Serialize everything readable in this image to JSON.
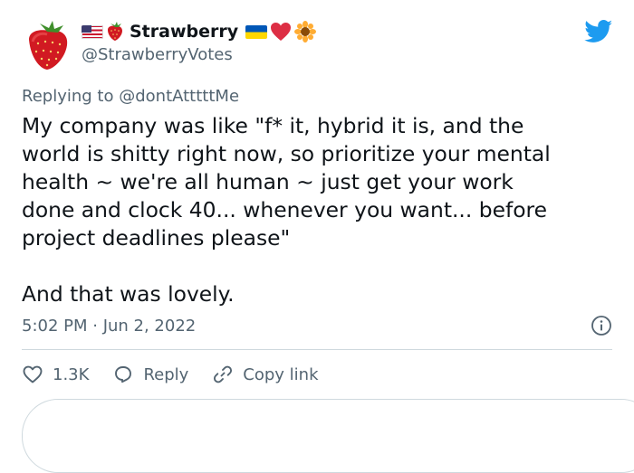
{
  "user": {
    "display_name": "Strawberry",
    "handle": "@StrawberryVotes",
    "badges_leading": [
      "us-flag-icon",
      "strawberry-icon"
    ],
    "badges_trailing": [
      "ukraine-flag-icon",
      "red-heart-icon",
      "sunflower-icon"
    ]
  },
  "reply_context": {
    "prefix": "Replying to",
    "mention": "@dontAtttttMe"
  },
  "tweet": {
    "text": "My company was like \"f* it, hybrid it is, and the\nworld is shitty right now, so prioritize your mental\nhealth ~ we're all human ~ just get your work\ndone and clock 40... whenever you want... before\nproject deadlines please\"\n\nAnd that was lovely.",
    "timestamp": "5:02 PM · Jun 2, 2022"
  },
  "actions": {
    "like_count": "1.3K",
    "reply_label": "Reply",
    "copy_link_label": "Copy link"
  },
  "colors": {
    "twitter_blue": "#1d9bf0",
    "text_primary": "#0f1419",
    "text_secondary": "#536471",
    "divider": "#cfd9de"
  }
}
